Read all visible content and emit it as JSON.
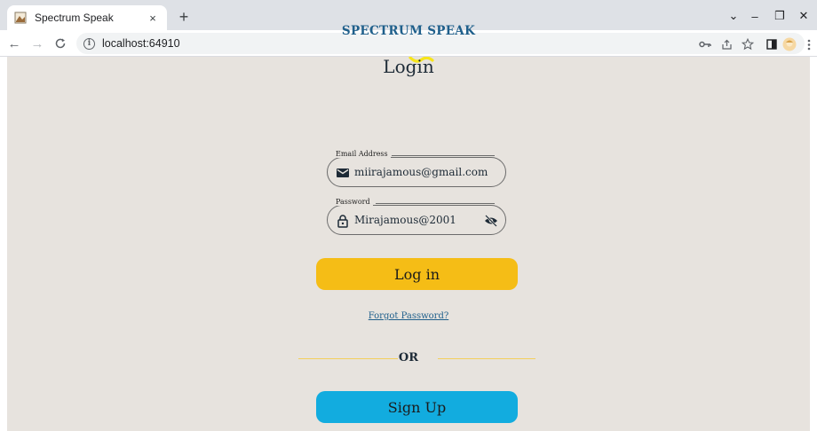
{
  "browser": {
    "tab": {
      "title": "Spectrum Speak",
      "close": "×"
    },
    "new_tab": "+",
    "window": {
      "chevron": "⌄",
      "minimize": "–",
      "restore": "❐",
      "close": "✕"
    },
    "nav": {
      "back": "←",
      "forward": "→",
      "reload": "C"
    },
    "url": "localhost:64910",
    "toolbar_icons": [
      "key-icon",
      "share-icon",
      "star-icon",
      "sidepanel-icon",
      "profile-avatar",
      "menu-icon"
    ]
  },
  "page": {
    "brand": "SPECTRUM SPEAK",
    "heading": "Login",
    "email": {
      "label": "Email Address",
      "value": "miirajamous@gmail.com"
    },
    "password": {
      "label": "Password",
      "value": "Mirajamous@2001"
    },
    "login_button": "Log in",
    "forgot_link": "Forgot Password?",
    "divider_text": "OR",
    "signup_button": "Sign Up"
  },
  "colors": {
    "page_background": "#e7e3de",
    "brand": "#1f5f8b",
    "login_button": "#f5bd16",
    "signup_button": "#12acdf",
    "divider": "#f4cf5b"
  }
}
